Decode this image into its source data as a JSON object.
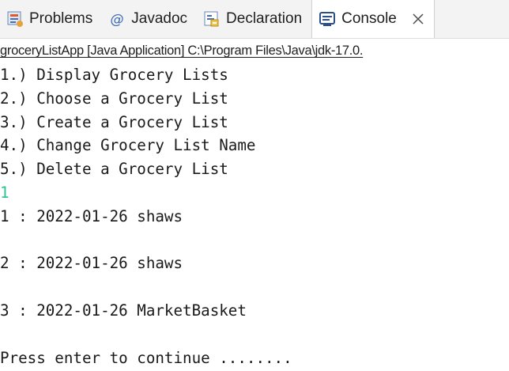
{
  "colors": {
    "tabbar_bg": "#f3f3f3",
    "active_tab_bg": "#ffffff",
    "console_text": "#1a1a1a",
    "user_input": "#27c48f",
    "console_icon": "#2a4f8a"
  },
  "tabs": [
    {
      "label": "Problems",
      "icon": "problems-icon",
      "active": false
    },
    {
      "label": "Javadoc",
      "icon": "javadoc-icon",
      "active": false
    },
    {
      "label": "Declaration",
      "icon": "declaration-icon",
      "active": false
    },
    {
      "label": "Console",
      "icon": "console-icon",
      "active": true,
      "closable": true
    }
  ],
  "console": {
    "launch_label": "groceryListApp [Java Application] C:\\Program Files\\Java\\jdk-17.0.",
    "lines": [
      {
        "text": "1.) Display Grocery Lists",
        "kind": "output"
      },
      {
        "text": "2.) Choose a Grocery List",
        "kind": "output"
      },
      {
        "text": "3.) Create a Grocery List",
        "kind": "output"
      },
      {
        "text": "4.) Change Grocery List Name",
        "kind": "output"
      },
      {
        "text": "5.) Delete a Grocery List",
        "kind": "output"
      },
      {
        "text": "1",
        "kind": "input"
      },
      {
        "text": "1 : 2022-01-26 shaws",
        "kind": "output"
      },
      {
        "text": "",
        "kind": "output"
      },
      {
        "text": "2 : 2022-01-26 shaws",
        "kind": "output"
      },
      {
        "text": "",
        "kind": "output"
      },
      {
        "text": "3 : 2022-01-26 MarketBasket",
        "kind": "output"
      },
      {
        "text": "",
        "kind": "output"
      },
      {
        "text": "Press enter to continue ........",
        "kind": "output"
      }
    ]
  }
}
